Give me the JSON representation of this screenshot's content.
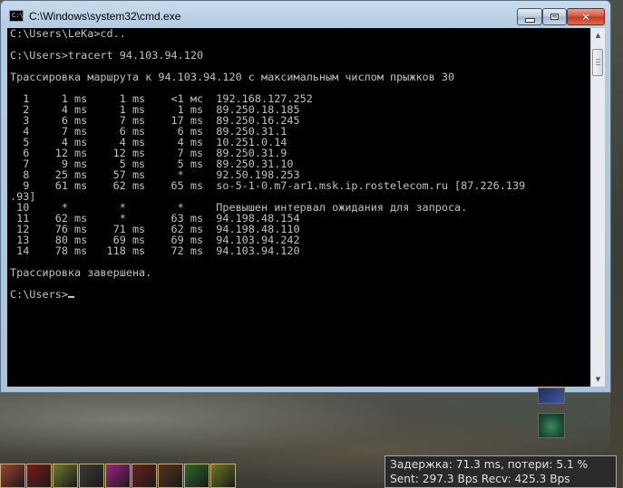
{
  "window": {
    "title": "C:\\Windows\\system32\\cmd.exe",
    "icon_label": "C:\\"
  },
  "console": {
    "lines": [
      "C:\\Users\\LeKa>cd..",
      "",
      "C:\\Users>tracert 94.103.94.120",
      "",
      "Трассировка маршрута к 94.103.94.120 с максимальным числом прыжков 30",
      "",
      "  1     1 ms     1 ms    <1 мс  192.168.127.252",
      "  2     4 ms     1 ms     1 ms  89.250.18.185",
      "  3     6 ms     7 ms    17 ms  89.250.16.245",
      "  4     7 ms     6 ms     6 ms  89.250.31.1",
      "  5     4 ms     4 ms     4 ms  10.251.0.14",
      "  6    12 ms    12 ms     7 ms  89.250.31.9",
      "  7     9 ms     5 ms     5 ms  89.250.31.10",
      "  8    25 ms    57 ms     *     92.50.198.253",
      "  9    61 ms    62 ms    65 ms  so-5-1-0.m7-ar1.msk.ip.rostelecom.ru [87.226.139",
      ".93]",
      " 10     *        *        *     Превышен интервал ожидания для запроса.",
      " 11    62 ms     *       63 ms  94.198.48.154",
      " 12    76 ms    71 ms    62 ms  94.198.48.110",
      " 13    80 ms    69 ms    69 ms  94.103.94.242",
      " 14    78 ms   118 ms    72 ms  94.103.94.120",
      "",
      "Трассировка завершена.",
      ""
    ],
    "prompt": "C:\\Users>"
  },
  "stats": {
    "line1": "Задержка: 71.3 ms, потери: 5.1 %",
    "line2": "Sent: 297.3 Bps Recv: 425.3 Bps"
  },
  "hotbar": {
    "slots": [
      {
        "icon": "scroll-icon",
        "color": "#a04030"
      },
      {
        "icon": "sword-icon",
        "color": "#7a1a1a"
      },
      {
        "icon": "spear-icon",
        "color": "#6b7a2a"
      },
      {
        "icon": "skeleton-icon",
        "color": "#3a3a3a"
      },
      {
        "icon": "magic-icon",
        "color": "#a0208a"
      },
      {
        "icon": "axe-icon",
        "color": "#6a2020"
      },
      {
        "icon": "bow-icon",
        "color": "#5a3020"
      },
      {
        "icon": "nature-icon",
        "color": "#2a6a2a"
      },
      {
        "icon": "staff-icon",
        "color": "#6a7a20"
      }
    ]
  }
}
